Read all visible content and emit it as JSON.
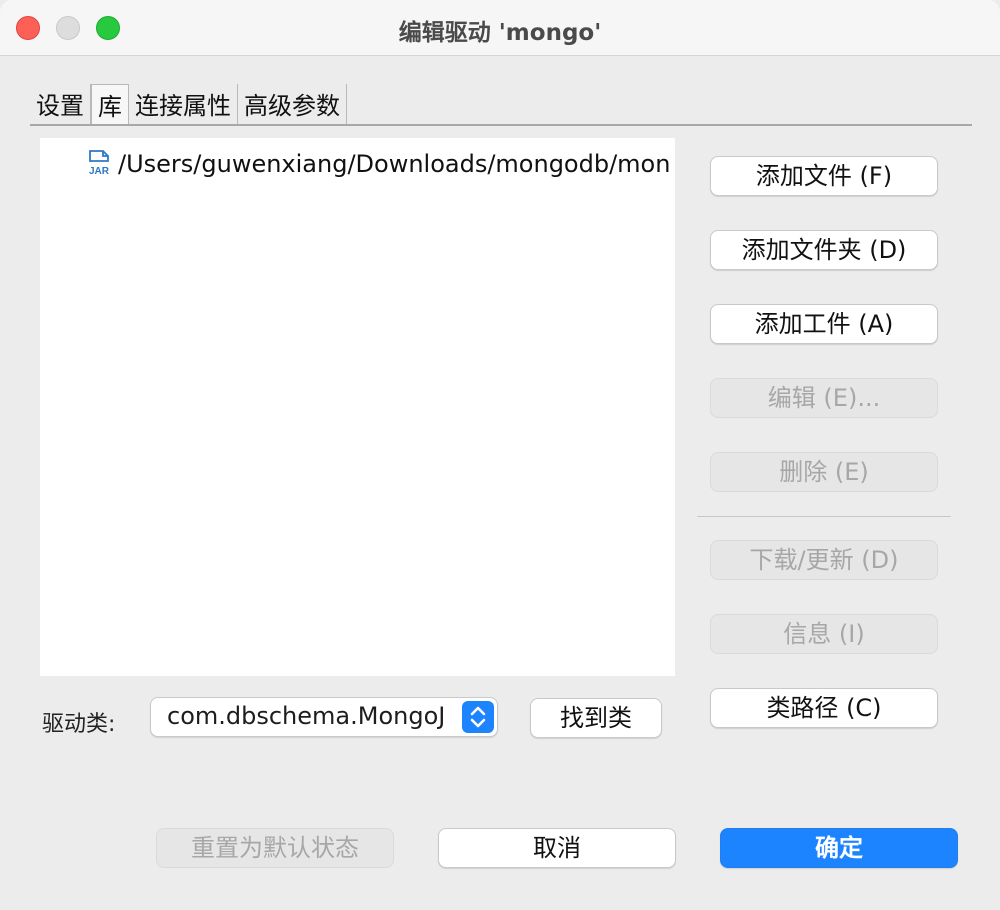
{
  "window": {
    "title": "编辑驱动 'mongo'"
  },
  "tabs": [
    {
      "label": "设置",
      "active": false
    },
    {
      "label": "库",
      "active": true
    },
    {
      "label": "连接属性",
      "active": false
    },
    {
      "label": "高级参数",
      "active": false
    }
  ],
  "library": {
    "items": [
      {
        "icon": "jar-file-icon",
        "path": "/Users/guwenxiang/Downloads/mongodb/mon"
      }
    ]
  },
  "buttons": {
    "add_file": "添加文件 (F)",
    "add_folder": "添加文件夹 (D)",
    "add_artifact": "添加工件 (A)",
    "edit": "编辑 (E)...",
    "delete": "删除 (E)",
    "download_update": "下载/更新 (D)",
    "info": "信息 (I)",
    "classpath": "类路径 (C)",
    "find_class": "找到类",
    "reset_default": "重置为默认状态",
    "cancel": "取消",
    "ok": "确定"
  },
  "driver_class": {
    "label": "驱动类:",
    "value": "com.dbschema.MongoJ"
  },
  "colors": {
    "accent": "#1c84ff",
    "close": "#fe5f57",
    "minimize": "#dddddd",
    "maximize": "#27c93f"
  }
}
